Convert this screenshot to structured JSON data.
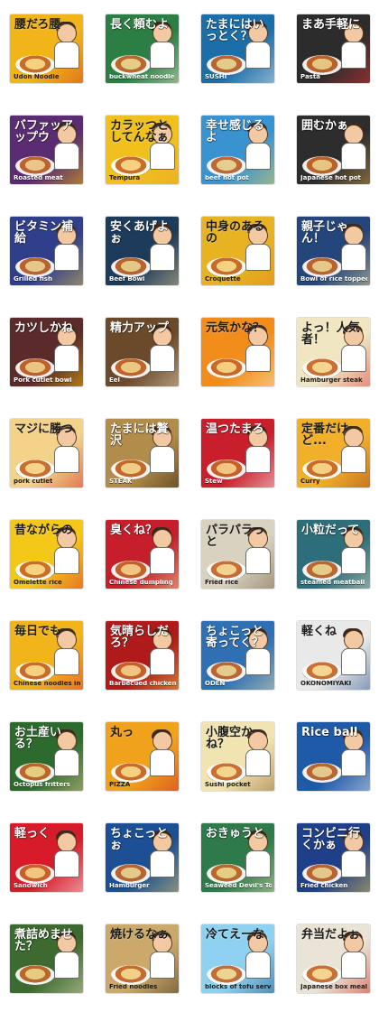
{
  "grid": {
    "stickers": [
      {
        "jp": "腰だろ腰",
        "en": "Udon Noodle",
        "bg": "#f1b51a",
        "accent": "#d23a1a",
        "dark": true
      },
      {
        "jp": "長く頼むよ",
        "en": "buckwheat noodle",
        "bg": "#2b7f44",
        "accent": "#f6f0d6",
        "dark": false
      },
      {
        "jp": "たまにはいっとく？",
        "en": "SUSHI",
        "bg": "#1b6ea8",
        "accent": "#f5f5f5",
        "dark": false
      },
      {
        "jp": "まあ手軽に",
        "en": "Pasta",
        "bg": "#2c2c2c",
        "accent": "#e33",
        "dark": false
      },
      {
        "jp": "バファッアップウ",
        "en": "Roasted meat",
        "bg": "#5a2c72",
        "accent": "#ffcc00",
        "dark": false
      },
      {
        "jp": "カラッつとしてんなぁ",
        "en": "Tempura",
        "bg": "#f0c11d",
        "accent": "#e9a12b",
        "dark": true
      },
      {
        "jp": "幸せ感じるよ",
        "en": "beef hot pot",
        "bg": "#3a93d1",
        "accent": "#f4d74a",
        "dark": false
      },
      {
        "jp": "囲むかぁ",
        "en": "Japanese hot pot",
        "bg": "#2d2d2d",
        "accent": "#d6a64a",
        "dark": false
      },
      {
        "jp": "ビタミン補給",
        "en": "Grilled fish",
        "bg": "#2f3f8c",
        "accent": "#f4c94a",
        "dark": false
      },
      {
        "jp": "安くあげよぉ",
        "en": "Beef Bowl",
        "bg": "#1d3b5a",
        "accent": "#f0d49a",
        "dark": false
      },
      {
        "jp": "中身のあるの",
        "en": "Croquette",
        "bg": "#e7b322",
        "accent": "#e1861a",
        "dark": true
      },
      {
        "jp": "親子じゃん！",
        "en": "Bowl of rice topped with chicken and egg",
        "bg": "#25467a",
        "accent": "#f6e7a0",
        "dark": false
      },
      {
        "jp": "カツしかね",
        "en": "Pork cutlet bowl",
        "bg": "#5b2a2a",
        "accent": "#ffcc00",
        "dark": false
      },
      {
        "jp": "精力アップ",
        "en": "Eel",
        "bg": "#6b4a2b",
        "accent": "#f2e6c6",
        "dark": false
      },
      {
        "jp": "元気かな？",
        "en": "",
        "bg": "#f28c1a",
        "accent": "#fff2cc",
        "dark": true
      },
      {
        "jp": "よっ！人気者！",
        "en": "Hamburger steak",
        "bg": "#f0e6c2",
        "accent": "#d33",
        "dark": true
      },
      {
        "jp": "マジに勝つ",
        "en": "pork cutlet",
        "bg": "#f3d38a",
        "accent": "#c22",
        "dark": true
      },
      {
        "jp": "たまには贅沢",
        "en": "STEAK",
        "bg": "#b28c4a",
        "accent": "#2a1a0a",
        "dark": false
      },
      {
        "jp": "温つたまろ",
        "en": "Stew",
        "bg": "#c91f2c",
        "accent": "#fff",
        "dark": false
      },
      {
        "jp": "定番だけど...",
        "en": "Curry",
        "bg": "#f2b02a",
        "accent": "#9a3b1a",
        "dark": true
      },
      {
        "jp": "昔ながらの",
        "en": "Omelette rice",
        "bg": "#f4c818",
        "accent": "#d23",
        "dark": true
      },
      {
        "jp": "臭くね？",
        "en": "Chinese dumpling",
        "bg": "#c61f2b",
        "accent": "#f7e7a8",
        "dark": false
      },
      {
        "jp": "パラパラっと",
        "en": "Fried rice",
        "bg": "#d9d2c0",
        "accent": "#6a5a3a",
        "dark": true
      },
      {
        "jp": "小粒だって",
        "en": "steamed meatball dumplings",
        "bg": "#2c6e7a",
        "accent": "#e8e0c4",
        "dark": false
      },
      {
        "jp": "毎日でも",
        "en": "Chinese noodles in soup",
        "bg": "#f1b41b",
        "accent": "#d33",
        "dark": true
      },
      {
        "jp": "気晴らしだろ？",
        "en": "Barbecued chicken",
        "bg": "#b01a1a",
        "accent": "#f2d54a",
        "dark": false
      },
      {
        "jp": "ちょこっと寄ってく？",
        "en": "ODEN",
        "bg": "#2f6fb3",
        "accent": "#f0e7b0",
        "dark": false
      },
      {
        "jp": "軽くね",
        "en": "OKONOMIYAKI",
        "bg": "#e9e9e9",
        "accent": "#1f4a8a",
        "dark": true
      },
      {
        "jp": "お土産いる？",
        "en": "Octopus fritters",
        "bg": "#2d6a2d",
        "accent": "#f0d49a",
        "dark": false
      },
      {
        "jp": "丸っ",
        "en": "PIZZA",
        "bg": "#f0a21d",
        "accent": "#c22",
        "dark": true
      },
      {
        "jp": "小腹空かね？",
        "en": "Sushi pocket",
        "bg": "#f1e4b0",
        "accent": "#8a5a2a",
        "dark": true
      },
      {
        "jp": "Rice ball",
        "en": "",
        "bg": "#1f5aa8",
        "accent": "#f2f2f2",
        "dark": false
      },
      {
        "jp": "軽っく",
        "en": "Sandwich",
        "bg": "#d61c2a",
        "accent": "#fff",
        "dark": false
      },
      {
        "jp": "ちょこっとぉ",
        "en": "Hamburger",
        "bg": "#1c4f93",
        "accent": "#f2d56a",
        "dark": false
      },
      {
        "jp": "おきゅうと",
        "en": "Seaweed Devil's Tongue",
        "bg": "#2f7a4a",
        "accent": "#f0e6c0",
        "dark": false
      },
      {
        "jp": "コンビニ行くかぁ",
        "en": "Fried chicken",
        "bg": "#1f3f8a",
        "accent": "#f7d24a",
        "dark": false
      },
      {
        "jp": "煮詰めませた？",
        "en": "",
        "bg": "#3d6a2f",
        "accent": "#f3e8c8",
        "dark": false
      },
      {
        "jp": "焼けるなぁ",
        "en": "Fried noodles",
        "bg": "#caa96a",
        "accent": "#3a2a1a",
        "dark": true
      },
      {
        "jp": "冷てえーな",
        "en": "blocks of tofu served cold",
        "bg": "#8fd1f0",
        "accent": "#1a4a7a",
        "dark": true
      },
      {
        "jp": "弁当だよぉ",
        "en": "Japanese box meal",
        "bg": "#e9e4d6",
        "accent": "#c21",
        "dark": true
      }
    ]
  }
}
